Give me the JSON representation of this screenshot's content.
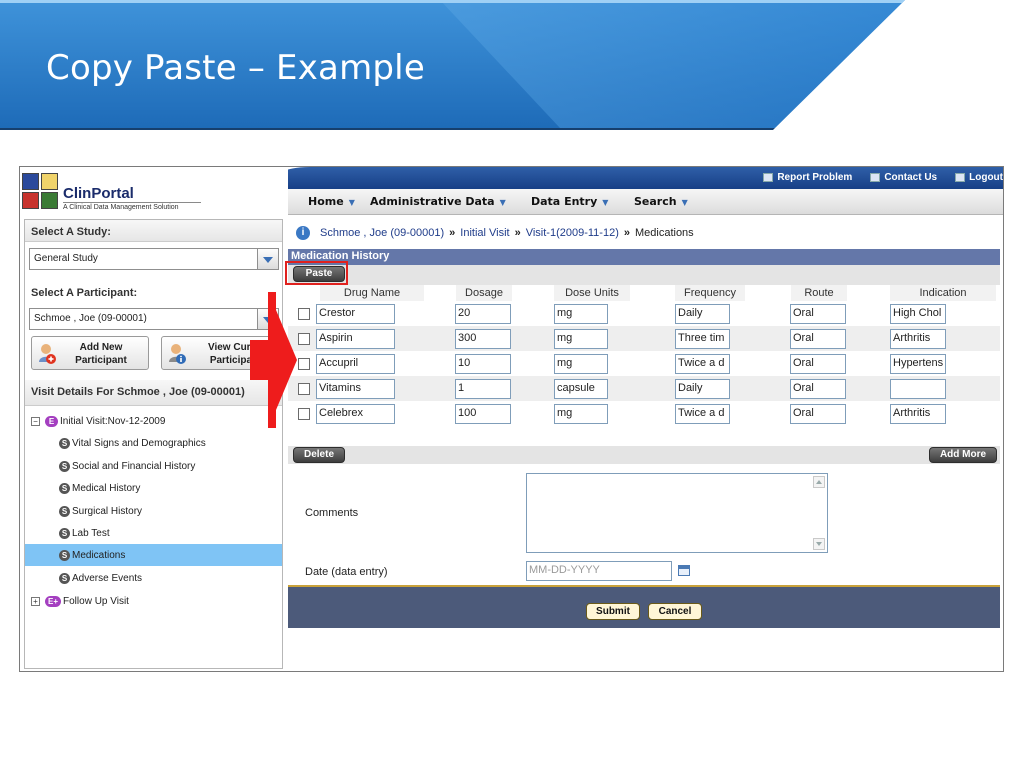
{
  "slide": {
    "title": "Copy Paste – Example"
  },
  "app": {
    "logo": {
      "name": "ClinPortal",
      "tagline": "A Clinical Data Management Solution"
    },
    "util_links": [
      "Report Problem",
      "Contact Us",
      "Logout"
    ],
    "menu": [
      "Home",
      "Administrative Data",
      "Data Entry",
      "Search"
    ],
    "sidebar": {
      "study_label": "Select A Study:",
      "study_value": "General Study",
      "participant_label": "Select A Participant:",
      "participant_value": "Schmoe , Joe (09-00001)",
      "add_participant": [
        "Add New",
        "Participant"
      ],
      "view_participant": [
        "View Curre",
        "Participan"
      ],
      "visit_details": "Visit Details For  Schmoe , Joe (09-00001)",
      "tree": {
        "initial_visit": {
          "badge": "E",
          "label": "Initial Visit:Nov-12-2009"
        },
        "forms": [
          {
            "badge": "S",
            "label": "Vital Signs and Demographics"
          },
          {
            "badge": "S",
            "label": "Social and Financial History"
          },
          {
            "badge": "S",
            "label": "Medical History"
          },
          {
            "badge": "S",
            "label": "Surgical History"
          },
          {
            "badge": "S",
            "label": "Lab Test"
          },
          {
            "badge": "S",
            "label": "Medications"
          },
          {
            "badge": "S",
            "label": "Adverse Events"
          }
        ],
        "follow_up": {
          "badge": "E+",
          "label": "Follow Up Visit"
        },
        "selected_index": 5
      }
    },
    "breadcrumb": {
      "participant": "Schmoe , Joe (09-00001)",
      "visit": "Initial Visit",
      "visit_date": "Visit-1(2009-11-12)",
      "current": "Medications"
    },
    "section_title": "Medication History",
    "paste_label": "Paste",
    "columns": [
      "Drug Name",
      "Dosage",
      "Dose Units",
      "Frequency",
      "Route",
      "Indication"
    ],
    "rows": [
      [
        "Crestor",
        "20",
        "mg",
        "Daily",
        "Oral",
        "High Chol"
      ],
      [
        "Aspirin",
        "300",
        "mg",
        "Three tim",
        "Oral",
        "Arthritis"
      ],
      [
        "Accupril",
        "10",
        "mg",
        "Twice a d",
        "Oral",
        "Hypertens"
      ],
      [
        "Vitamins",
        "1",
        "capsule",
        "Daily",
        "Oral",
        ""
      ],
      [
        "Celebrex",
        "100",
        "mg",
        "Twice a d",
        "Oral",
        "Arthritis"
      ]
    ],
    "delete_label": "Delete",
    "add_more_label": "Add More",
    "comments_label": "Comments",
    "comments_value": "",
    "date_label": "Date (data entry)",
    "date_placeholder": "MM-DD-YYYY",
    "submit_label": "Submit",
    "cancel_label": "Cancel"
  },
  "colors": {
    "banner_blue": "#1f72c4",
    "section_header": "#6477a9",
    "footer_band": "#4c5a7a",
    "selected_row": "#7fc4f5",
    "highlight_red": "#e0211e",
    "badge_visit": "#a43fc0"
  }
}
